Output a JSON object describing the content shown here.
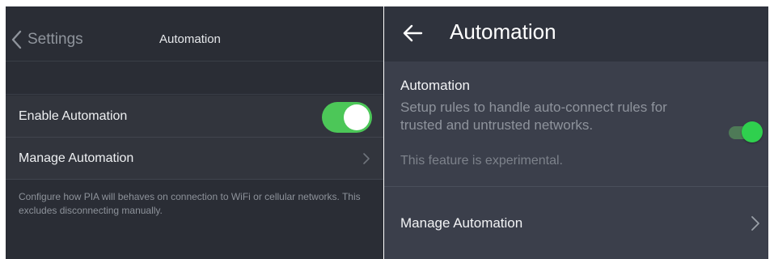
{
  "ios": {
    "back_label": "Settings",
    "title": "Automation",
    "enable_label": "Enable Automation",
    "enable_on": true,
    "manage_label": "Manage Automation",
    "footer": "Configure how PIA will behaves on connection to WiFi or cellular networks. This excludes disconnecting manually.",
    "icons": {
      "back": "chevron-left-icon",
      "manage": "chevron-right-icon"
    },
    "colors": {
      "toggle_on": "#4cc758",
      "background": "#2a2d35"
    }
  },
  "android": {
    "title": "Automation",
    "heading": "Automation",
    "description": "Setup rules to handle auto-connect rules for trusted and untrusted networks.",
    "experimental": "This feature is experimental.",
    "switch_on": true,
    "manage_label": "Manage Automation",
    "icons": {
      "back": "arrow-left-icon",
      "manage": "chevron-right-icon"
    },
    "colors": {
      "switch_thumb": "#2fd04e",
      "background": "#3b3f4b"
    }
  }
}
